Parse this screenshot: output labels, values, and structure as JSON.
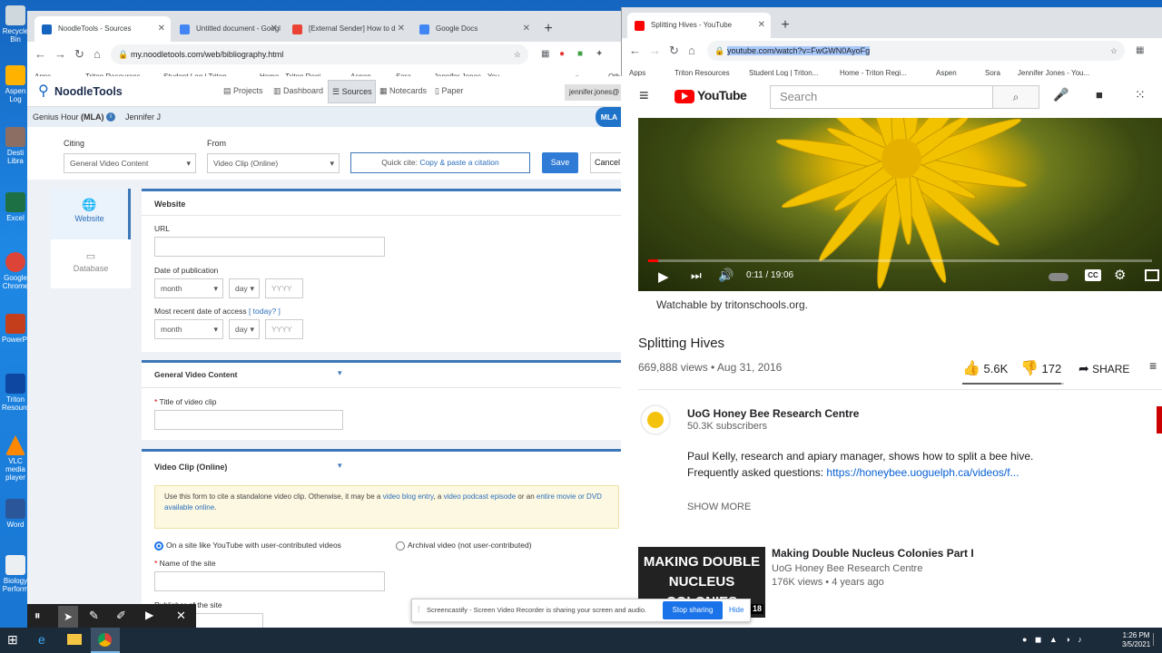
{
  "desktop": {
    "icons": [
      "Recycle Bin",
      "Aspen Log",
      "Desti Libra",
      "Excel",
      "Google Chrome",
      "PowerPoint",
      "Triton Resources",
      "VLC media player",
      "Word",
      "Biology Perform"
    ]
  },
  "left": {
    "tabs": [
      "NoodleTools - Sources",
      "Untitled document - Googl",
      "[External Sender] How to d",
      "Google Docs"
    ],
    "url": "my.noodletools.com/web/bibliography.html",
    "bookmarks": [
      "Apps",
      "Triton Resources",
      "Student Log | Triton...",
      "Home - Triton Regi...",
      "Aspen",
      "Sora",
      "Jennifer Jones - You...",
      "»",
      "Oth"
    ],
    "logo": "NoodleTools",
    "nav": [
      "Projects",
      "Dashboard",
      "Sources",
      "Notecards",
      "Paper"
    ],
    "user": "jennifer.jones@",
    "project": "Genius Hour",
    "style": "(MLA)",
    "owner": "Jennifer J",
    "mla_badge": "MLA",
    "citing_label": "Citing",
    "citing_value": "General Video Content",
    "from_label": "From",
    "from_value": "Video Clip (Online)",
    "quickcite_prefix": "Quick cite:",
    "quickcite_link": "Copy & paste a citation",
    "save": "Save",
    "cancel": "Cancel",
    "side_website": "Website",
    "side_database": "Database",
    "website_title": "Website",
    "url_label": "URL",
    "pubdate_label": "Date of publication",
    "access_label": "Most recent date of access",
    "today": "[ today? ]",
    "month": "month",
    "day": "day",
    "year": "YYYY",
    "gvc_title": "General Video Content",
    "title_label": "* Title of video clip",
    "vco_title": "Video Clip (Online)",
    "notice_a": "Use this form to cite a standalone video clip. Otherwise, it may be a ",
    "notice_l1": "video blog entry",
    "notice_b": ", a ",
    "notice_l2": "video podcast episode",
    "notice_c": " or an ",
    "notice_l3": "entire movie or DVD available online",
    "notice_d": ".",
    "radio1": "On a site like YouTube with user-contributed videos",
    "radio2": "Archival video (not user-contributed)",
    "site_label": "* Name of the site",
    "publisher_label": "Publisher of the site"
  },
  "right": {
    "tab": "Splitting Hives - YouTube",
    "url": "youtube.com/watch?v=FwGWN0AyoFg",
    "bookmarks": [
      "Apps",
      "Triton Resources",
      "Student Log | Triton...",
      "Home - Triton Regi...",
      "Aspen",
      "Sora",
      "Jennifer Jones - You..."
    ],
    "search": "Search",
    "time": "0:11 / 19:06",
    "watchable": "Watchable by tritonschools.org.",
    "title": "Splitting Hives",
    "views": "669,888 views • Aug 31, 2016",
    "likes": "5.6K",
    "dislikes": "172",
    "share": "SHARE",
    "channel": "UoG Honey Bee Research Centre",
    "subs": "50.3K subscribers",
    "desc1": "Paul Kelly, research and apiary manager, shows how to split a bee hive.",
    "desc2_prefix": "Frequently asked questions: ",
    "desc2_link": "https://honeybee.uoguelph.ca/videos/f...",
    "show_more": "SHOW MORE",
    "rec_thumb": "MAKING DOUBLE NUCLEUS COLONIES",
    "rec_title": "Making Double Nucleus Colonies Part I",
    "rec_channel": "UoG Honey Bee Research Centre",
    "rec_meta": "176K views • 4 years ago",
    "rec_badge": "18"
  },
  "screencastify": {
    "text": "Screencastify - Screen Video Recorder is sharing your screen and audio.",
    "stop": "Stop sharing",
    "hide": "Hide"
  },
  "taskbar": {
    "time": "1:26 PM",
    "date": "3/5/2021"
  }
}
